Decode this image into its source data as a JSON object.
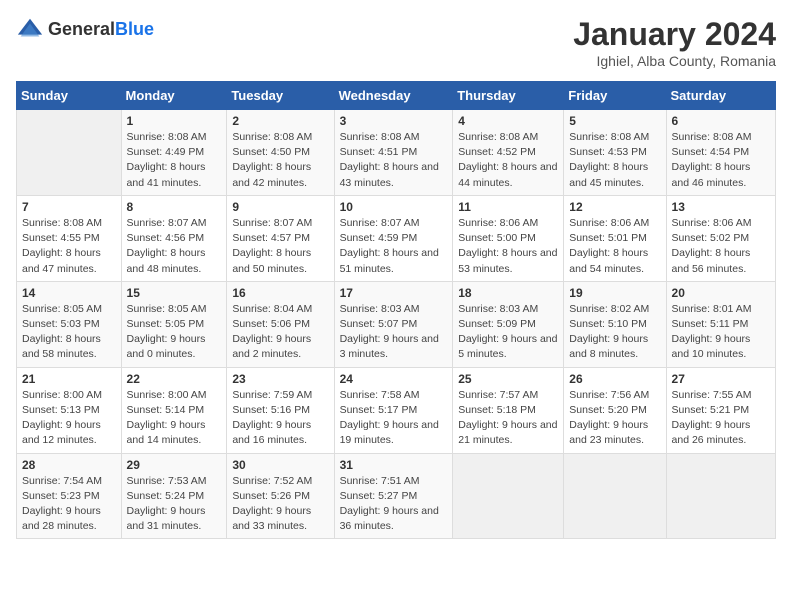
{
  "logo": {
    "general": "General",
    "blue": "Blue"
  },
  "header": {
    "title": "January 2024",
    "subtitle": "Ighiel, Alba County, Romania"
  },
  "weekdays": [
    "Sunday",
    "Monday",
    "Tuesday",
    "Wednesday",
    "Thursday",
    "Friday",
    "Saturday"
  ],
  "weeks": [
    [
      {
        "day": "",
        "sunrise": "",
        "sunset": "",
        "daylight": ""
      },
      {
        "day": "1",
        "sunrise": "Sunrise: 8:08 AM",
        "sunset": "Sunset: 4:49 PM",
        "daylight": "Daylight: 8 hours and 41 minutes."
      },
      {
        "day": "2",
        "sunrise": "Sunrise: 8:08 AM",
        "sunset": "Sunset: 4:50 PM",
        "daylight": "Daylight: 8 hours and 42 minutes."
      },
      {
        "day": "3",
        "sunrise": "Sunrise: 8:08 AM",
        "sunset": "Sunset: 4:51 PM",
        "daylight": "Daylight: 8 hours and 43 minutes."
      },
      {
        "day": "4",
        "sunrise": "Sunrise: 8:08 AM",
        "sunset": "Sunset: 4:52 PM",
        "daylight": "Daylight: 8 hours and 44 minutes."
      },
      {
        "day": "5",
        "sunrise": "Sunrise: 8:08 AM",
        "sunset": "Sunset: 4:53 PM",
        "daylight": "Daylight: 8 hours and 45 minutes."
      },
      {
        "day": "6",
        "sunrise": "Sunrise: 8:08 AM",
        "sunset": "Sunset: 4:54 PM",
        "daylight": "Daylight: 8 hours and 46 minutes."
      }
    ],
    [
      {
        "day": "7",
        "sunrise": "Sunrise: 8:08 AM",
        "sunset": "Sunset: 4:55 PM",
        "daylight": "Daylight: 8 hours and 47 minutes."
      },
      {
        "day": "8",
        "sunrise": "Sunrise: 8:07 AM",
        "sunset": "Sunset: 4:56 PM",
        "daylight": "Daylight: 8 hours and 48 minutes."
      },
      {
        "day": "9",
        "sunrise": "Sunrise: 8:07 AM",
        "sunset": "Sunset: 4:57 PM",
        "daylight": "Daylight: 8 hours and 50 minutes."
      },
      {
        "day": "10",
        "sunrise": "Sunrise: 8:07 AM",
        "sunset": "Sunset: 4:59 PM",
        "daylight": "Daylight: 8 hours and 51 minutes."
      },
      {
        "day": "11",
        "sunrise": "Sunrise: 8:06 AM",
        "sunset": "Sunset: 5:00 PM",
        "daylight": "Daylight: 8 hours and 53 minutes."
      },
      {
        "day": "12",
        "sunrise": "Sunrise: 8:06 AM",
        "sunset": "Sunset: 5:01 PM",
        "daylight": "Daylight: 8 hours and 54 minutes."
      },
      {
        "day": "13",
        "sunrise": "Sunrise: 8:06 AM",
        "sunset": "Sunset: 5:02 PM",
        "daylight": "Daylight: 8 hours and 56 minutes."
      }
    ],
    [
      {
        "day": "14",
        "sunrise": "Sunrise: 8:05 AM",
        "sunset": "Sunset: 5:03 PM",
        "daylight": "Daylight: 8 hours and 58 minutes."
      },
      {
        "day": "15",
        "sunrise": "Sunrise: 8:05 AM",
        "sunset": "Sunset: 5:05 PM",
        "daylight": "Daylight: 9 hours and 0 minutes."
      },
      {
        "day": "16",
        "sunrise": "Sunrise: 8:04 AM",
        "sunset": "Sunset: 5:06 PM",
        "daylight": "Daylight: 9 hours and 2 minutes."
      },
      {
        "day": "17",
        "sunrise": "Sunrise: 8:03 AM",
        "sunset": "Sunset: 5:07 PM",
        "daylight": "Daylight: 9 hours and 3 minutes."
      },
      {
        "day": "18",
        "sunrise": "Sunrise: 8:03 AM",
        "sunset": "Sunset: 5:09 PM",
        "daylight": "Daylight: 9 hours and 5 minutes."
      },
      {
        "day": "19",
        "sunrise": "Sunrise: 8:02 AM",
        "sunset": "Sunset: 5:10 PM",
        "daylight": "Daylight: 9 hours and 8 minutes."
      },
      {
        "day": "20",
        "sunrise": "Sunrise: 8:01 AM",
        "sunset": "Sunset: 5:11 PM",
        "daylight": "Daylight: 9 hours and 10 minutes."
      }
    ],
    [
      {
        "day": "21",
        "sunrise": "Sunrise: 8:00 AM",
        "sunset": "Sunset: 5:13 PM",
        "daylight": "Daylight: 9 hours and 12 minutes."
      },
      {
        "day": "22",
        "sunrise": "Sunrise: 8:00 AM",
        "sunset": "Sunset: 5:14 PM",
        "daylight": "Daylight: 9 hours and 14 minutes."
      },
      {
        "day": "23",
        "sunrise": "Sunrise: 7:59 AM",
        "sunset": "Sunset: 5:16 PM",
        "daylight": "Daylight: 9 hours and 16 minutes."
      },
      {
        "day": "24",
        "sunrise": "Sunrise: 7:58 AM",
        "sunset": "Sunset: 5:17 PM",
        "daylight": "Daylight: 9 hours and 19 minutes."
      },
      {
        "day": "25",
        "sunrise": "Sunrise: 7:57 AM",
        "sunset": "Sunset: 5:18 PM",
        "daylight": "Daylight: 9 hours and 21 minutes."
      },
      {
        "day": "26",
        "sunrise": "Sunrise: 7:56 AM",
        "sunset": "Sunset: 5:20 PM",
        "daylight": "Daylight: 9 hours and 23 minutes."
      },
      {
        "day": "27",
        "sunrise": "Sunrise: 7:55 AM",
        "sunset": "Sunset: 5:21 PM",
        "daylight": "Daylight: 9 hours and 26 minutes."
      }
    ],
    [
      {
        "day": "28",
        "sunrise": "Sunrise: 7:54 AM",
        "sunset": "Sunset: 5:23 PM",
        "daylight": "Daylight: 9 hours and 28 minutes."
      },
      {
        "day": "29",
        "sunrise": "Sunrise: 7:53 AM",
        "sunset": "Sunset: 5:24 PM",
        "daylight": "Daylight: 9 hours and 31 minutes."
      },
      {
        "day": "30",
        "sunrise": "Sunrise: 7:52 AM",
        "sunset": "Sunset: 5:26 PM",
        "daylight": "Daylight: 9 hours and 33 minutes."
      },
      {
        "day": "31",
        "sunrise": "Sunrise: 7:51 AM",
        "sunset": "Sunset: 5:27 PM",
        "daylight": "Daylight: 9 hours and 36 minutes."
      },
      {
        "day": "",
        "sunrise": "",
        "sunset": "",
        "daylight": ""
      },
      {
        "day": "",
        "sunrise": "",
        "sunset": "",
        "daylight": ""
      },
      {
        "day": "",
        "sunrise": "",
        "sunset": "",
        "daylight": ""
      }
    ]
  ]
}
